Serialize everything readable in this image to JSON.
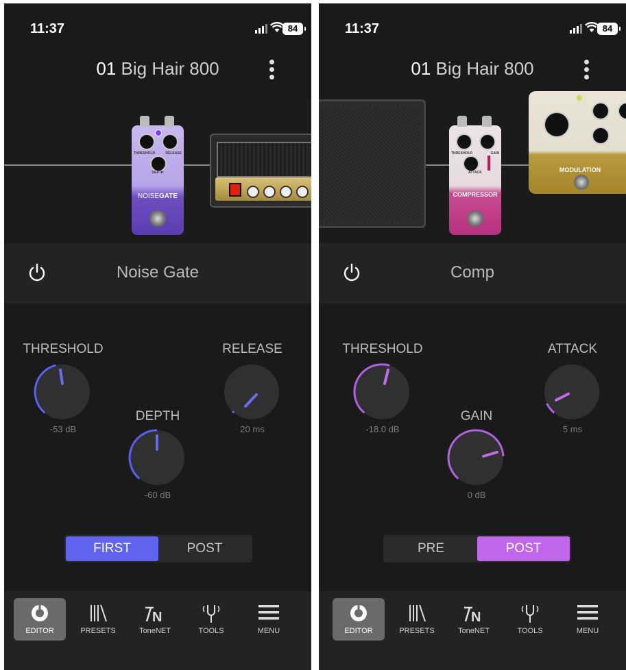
{
  "colors": {
    "left_accent": "#6a6cf0",
    "right_accent": "#c16be8",
    "background": "#1a1a1a"
  },
  "screens": [
    {
      "status": {
        "time": "11:37",
        "battery": "84"
      },
      "preset": {
        "number": "01",
        "name": "Big Hair 800"
      },
      "pedal": {
        "name_top": "NOISE",
        "name_bottom": "GATE",
        "knob_labels": [
          "THRESHOLD",
          "RELEASE",
          "DEPTH"
        ]
      },
      "effect": {
        "title": "Noise Gate"
      },
      "knobs": [
        {
          "label": "THRESHOLD",
          "value": "-53 dB"
        },
        {
          "label": "RELEASE",
          "value": "20 ms"
        },
        {
          "label": "DEPTH",
          "value": "-60 dB"
        }
      ],
      "toggle": {
        "options": [
          "FIRST",
          "POST"
        ],
        "selected": "FIRST"
      },
      "tabs": [
        "EDITOR",
        "PRESETS",
        "ToneNET",
        "TOOLS",
        "MENU"
      ],
      "active_tab": "EDITOR"
    },
    {
      "status": {
        "time": "11:37",
        "battery": "84"
      },
      "preset": {
        "number": "01",
        "name": "Big Hair 800"
      },
      "pedal": {
        "name": "COMPRESSOR",
        "knob_labels": [
          "THRESHOLD",
          "GAIN",
          "ATTACK"
        ],
        "next_pedal": "MODULATION"
      },
      "effect": {
        "title": "Comp"
      },
      "knobs": [
        {
          "label": "THRESHOLD",
          "value": "-18.0 dB"
        },
        {
          "label": "ATTACK",
          "value": "5 ms"
        },
        {
          "label": "GAIN",
          "value": "0 dB"
        }
      ],
      "toggle": {
        "options": [
          "PRE",
          "POST"
        ],
        "selected": "POST"
      },
      "tabs": [
        "EDITOR",
        "PRESETS",
        "ToneNET",
        "TOOLS",
        "MENU"
      ],
      "active_tab": "EDITOR"
    }
  ]
}
